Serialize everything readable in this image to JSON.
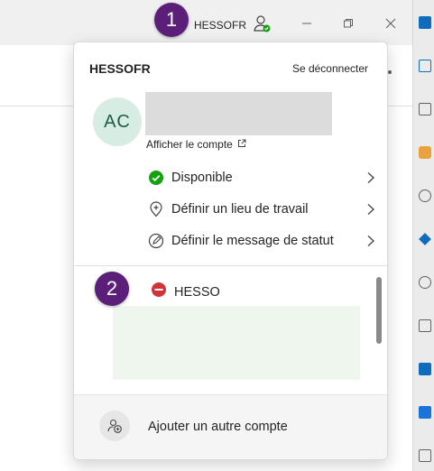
{
  "titlebar": {
    "account_label": "HESSOFR"
  },
  "markers": {
    "step1": "1",
    "step2": "2"
  },
  "panel": {
    "tenant_name": "HESSOFR",
    "signout_label": "Se déconnecter",
    "avatar_initials": "AC",
    "view_account_label": "Afficher le compte",
    "menu": [
      {
        "label": "Disponible",
        "icon": "available-status-icon"
      },
      {
        "label": "Définir un lieu de travail",
        "icon": "location-icon"
      },
      {
        "label": "Définir le message de statut",
        "icon": "status-message-icon"
      }
    ],
    "other_account": {
      "label": "HESSO",
      "status": "do-not-disturb"
    },
    "add_account_label": "Ajouter un autre compte"
  },
  "colors": {
    "available": "#13a10e",
    "dnd": "#d13438",
    "marker": "#5b1f7a",
    "avatar_bg": "#d7ece3",
    "avatar_text": "#1f5d45"
  }
}
